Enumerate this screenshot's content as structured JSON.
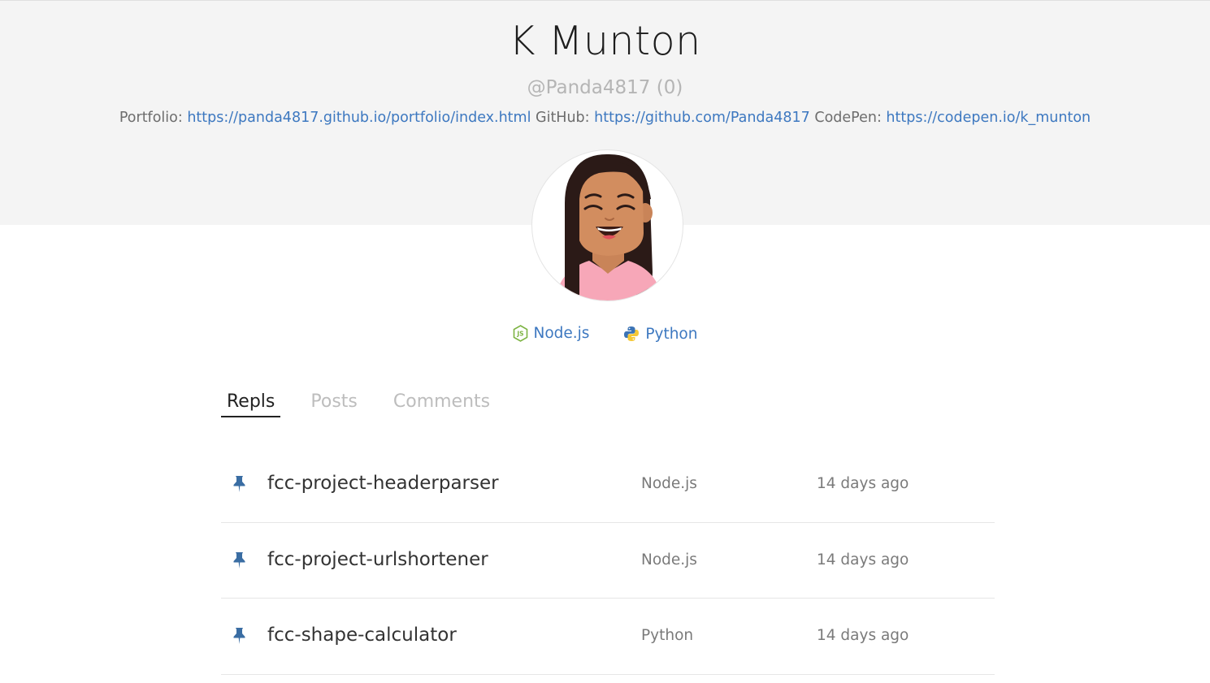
{
  "profile": {
    "name": "K Munton",
    "handle": "@Panda4817",
    "score": "(0)",
    "links": [
      {
        "label": "Portfolio:",
        "url": "https://panda4817.github.io/portfolio/index.html"
      },
      {
        "label": "GitHub:",
        "url": "https://github.com/Panda4817"
      },
      {
        "label": "CodePen:",
        "url": "https://codepen.io/k_munton"
      }
    ]
  },
  "languages": [
    {
      "name": "Node.js",
      "icon": "nodejs-icon"
    },
    {
      "name": "Python",
      "icon": "python-icon"
    }
  ],
  "tabs": [
    {
      "label": "Repls",
      "active": true
    },
    {
      "label": "Posts",
      "active": false
    },
    {
      "label": "Comments",
      "active": false
    }
  ],
  "repls": [
    {
      "title": "fcc-project-headerparser",
      "language": "Node.js",
      "updated": "14 days ago",
      "pinned": true
    },
    {
      "title": "fcc-project-urlshortener",
      "language": "Node.js",
      "updated": "14 days ago",
      "pinned": true
    },
    {
      "title": "fcc-shape-calculator",
      "language": "Python",
      "updated": "14 days ago",
      "pinned": true
    }
  ],
  "colors": {
    "header_bg": "#f4f4f4",
    "link": "#3d78c0",
    "pin": "#3a6da3"
  }
}
